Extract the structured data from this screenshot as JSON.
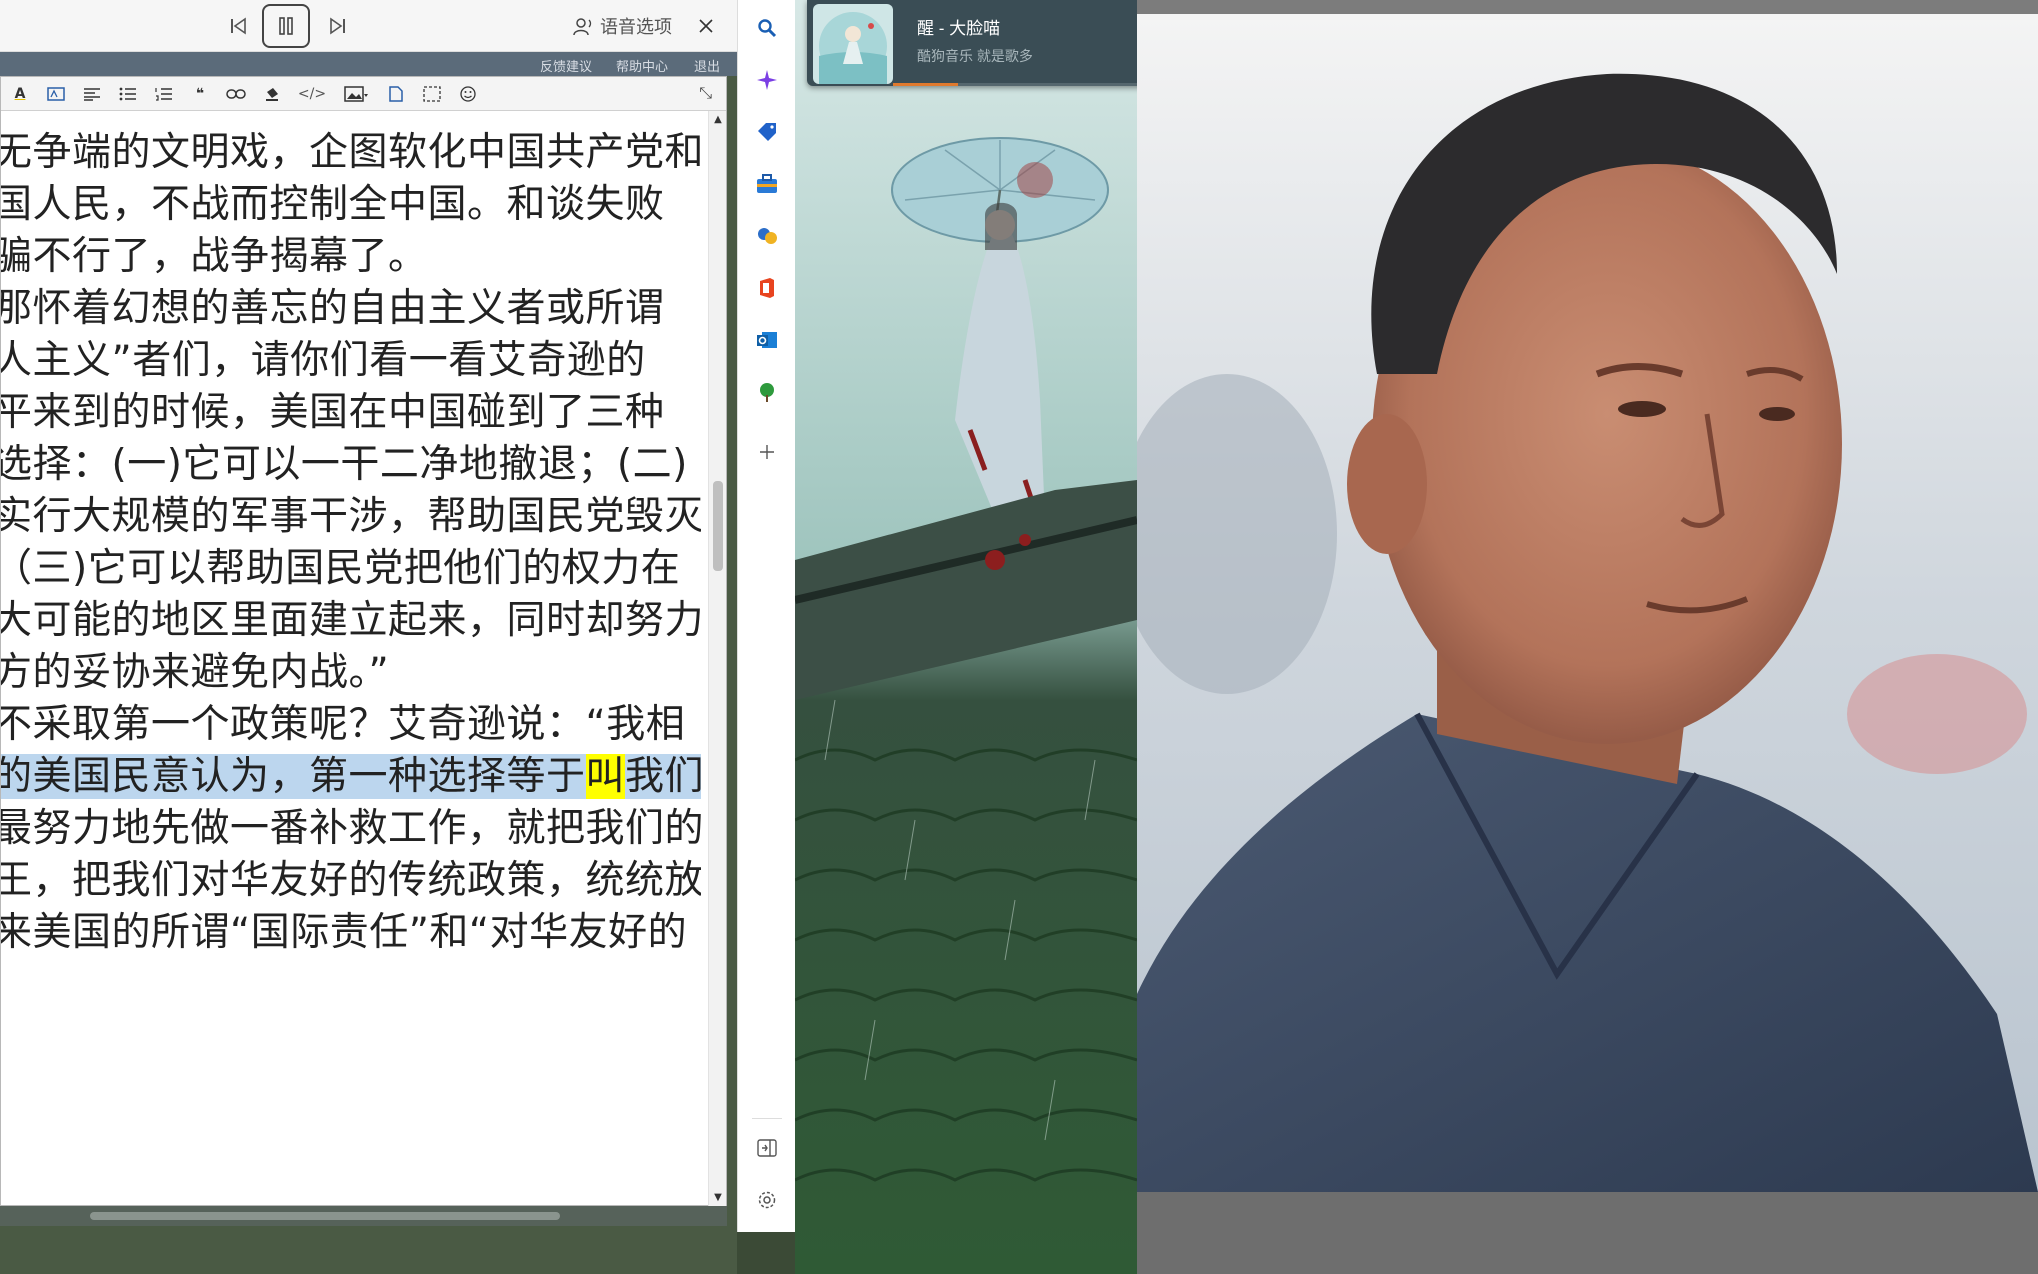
{
  "tts": {
    "voice_label": "语音选项"
  },
  "strip": {
    "feedback": "反馈建议",
    "help": "帮助中心",
    "logout": "退出"
  },
  "editor": {
    "lines": [
      "无争端的文明戏，企图软化中国共产党和",
      "国人民，不战而控制全中国。和谈失败",
      "骗不行了，战争揭幕了。",
      "那怀着幻想的善忘的自由主义者或所谓",
      "人主义”者们，请你们看一看艾奇逊的",
      "平来到的时候，美国在中国碰到了三种",
      "选择：(一)它可以一干二净地撤退；(二)",
      "实行大规模的军事干涉，帮助国民党毁灭",
      "（三)它可以帮助国民党把他们的权力在",
      "大可能的地区里面建立起来，同时却努力",
      "方的妥协来避免内战。”",
      "不采取第一个政策呢？艾奇逊说：“我相",
      "的美国民意认为，第一种选择等于",
      "最努力地先做一番补救工作，就把我们的",
      "王，把我们对华友好的传统政策，统统放",
      "来美国的所谓“国际责任”和“对华友好的"
    ],
    "highlight_word": "叫",
    "highlight_tail": "我们"
  },
  "music": {
    "title": "醒 - 大脸喵",
    "subtitle": "酷狗音乐  就是歌多",
    "progress": 0.17
  },
  "colors": {
    "sentence_highlight": "#bcd6ee",
    "word_highlight": "#ffff00",
    "music_progress": "#e07a2e"
  }
}
